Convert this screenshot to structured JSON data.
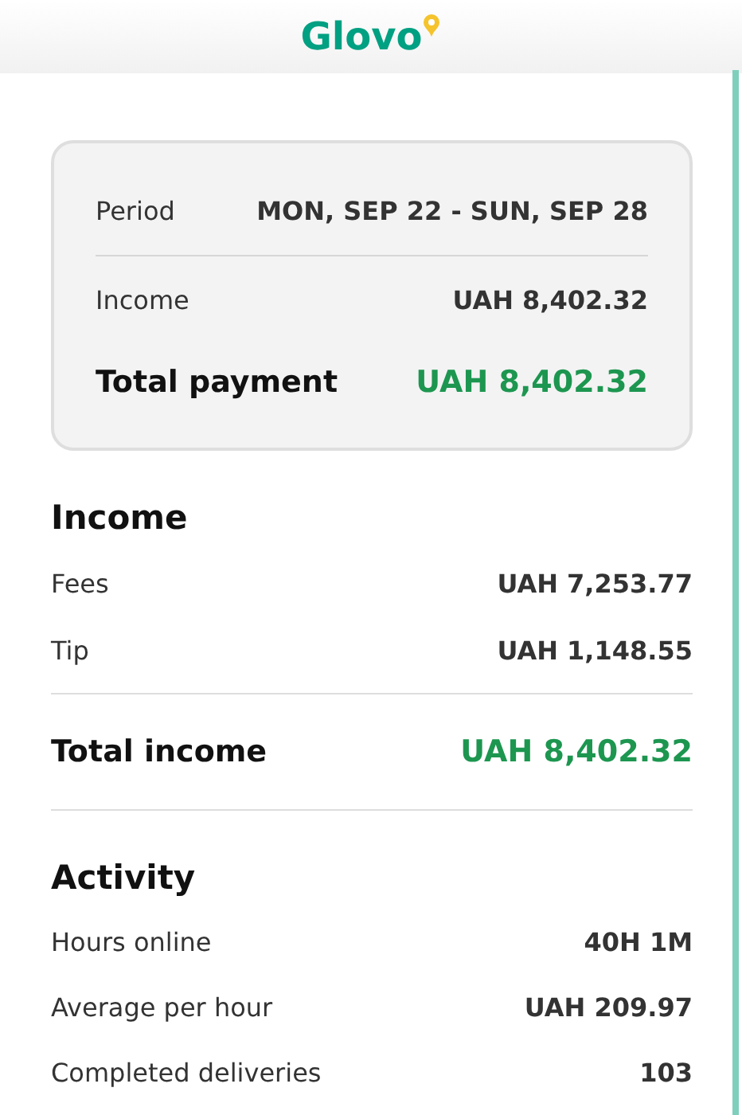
{
  "header": {
    "logo": "Glovo"
  },
  "summary": [
    {
      "kind": "period",
      "label": "Period",
      "value": "MON, SEP 22 - SUN, SEP 28"
    },
    {
      "kind": "item",
      "label": "Income",
      "value": "UAH 8,402.32"
    },
    {
      "kind": "total",
      "label": "Total payment",
      "value": "UAH 8,402.32"
    }
  ],
  "sections": [
    {
      "title": "Income",
      "rows": [
        {
          "kind": "item",
          "label": "Fees",
          "value": "UAH 7,253.77"
        },
        {
          "kind": "item",
          "label": "Tip",
          "value": "UAH 1,148.55"
        },
        {
          "kind": "total",
          "label": "Total income",
          "value": "UAH 8,402.32"
        }
      ]
    },
    {
      "title": "Activity",
      "rows": [
        {
          "kind": "item",
          "label": "Hours online",
          "value": "40H 1M"
        },
        {
          "kind": "item",
          "label": "Average per hour",
          "value": "UAH 209.97"
        },
        {
          "kind": "item",
          "label": "Completed deliveries",
          "value": "103"
        }
      ]
    }
  ]
}
